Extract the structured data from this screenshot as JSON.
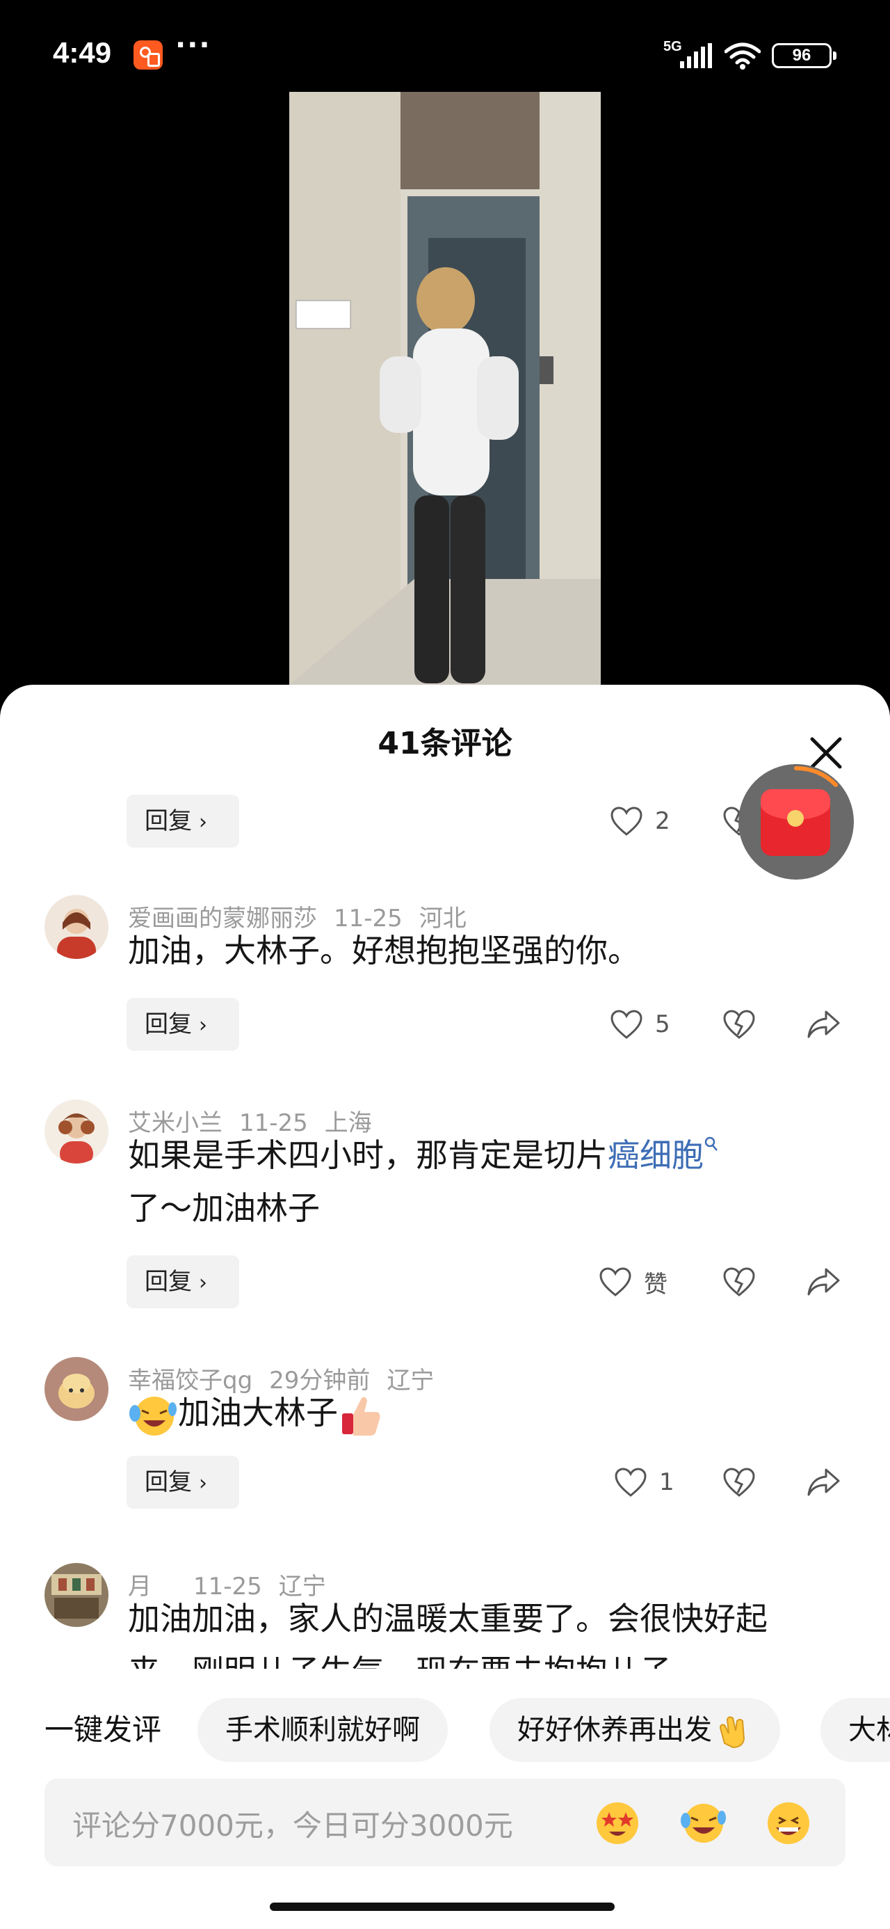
{
  "status_bar": {
    "time": "4:49",
    "signal_label": "5G",
    "battery": "96"
  },
  "sheet": {
    "title": "41条评论"
  },
  "top_actions": {
    "reply_label": "回复",
    "like_count": "2"
  },
  "comments": [
    {
      "username": "爱画画的蒙娜丽莎",
      "date": "11-25",
      "location": "河北",
      "text": "加油，大林子。好想抱抱坚强的你。",
      "reply_label": "回复",
      "like_count": "5"
    },
    {
      "username": "艾米小兰",
      "date": "11-25",
      "location": "上海",
      "text_before": "如果是手术四小时，那肯定是切片",
      "text_link": "癌细胞",
      "text_after": "了～加油林子",
      "reply_label": "回复",
      "like_count": "赞"
    },
    {
      "username": "幸福饺子qg",
      "date": "29分钟前",
      "location": "辽宁",
      "text": "加油大林子",
      "reply_label": "回复",
      "like_count": "1"
    },
    {
      "username": "月",
      "date": "11-25",
      "location": "辽宁",
      "text": "加油加油，家人的温暖太重要了。会很快好起来，刚明儿子生气，现在要去抱抱儿子"
    }
  ],
  "quick_replies": {
    "label": "一键发评",
    "chips": [
      "手术顺利就好啊",
      "好好休养再出发",
      "大林"
    ]
  },
  "input": {
    "placeholder": "评论分7000元，今日可分3000元"
  },
  "icons": {
    "status": [
      "app-logo-icon",
      "more-icon",
      "signal-icon",
      "wifi-icon",
      "battery-icon"
    ],
    "comment_actions": [
      "heart-icon",
      "broken-heart-icon",
      "share-icon"
    ],
    "input_emojis": [
      "star-eyes-emoji-icon",
      "laugh-cry-emoji-icon",
      "grin-emoji-icon"
    ]
  },
  "colors": {
    "link": "#3d6db5",
    "red_packet": "#e8262d",
    "app_badge": "#ff5a1f"
  }
}
